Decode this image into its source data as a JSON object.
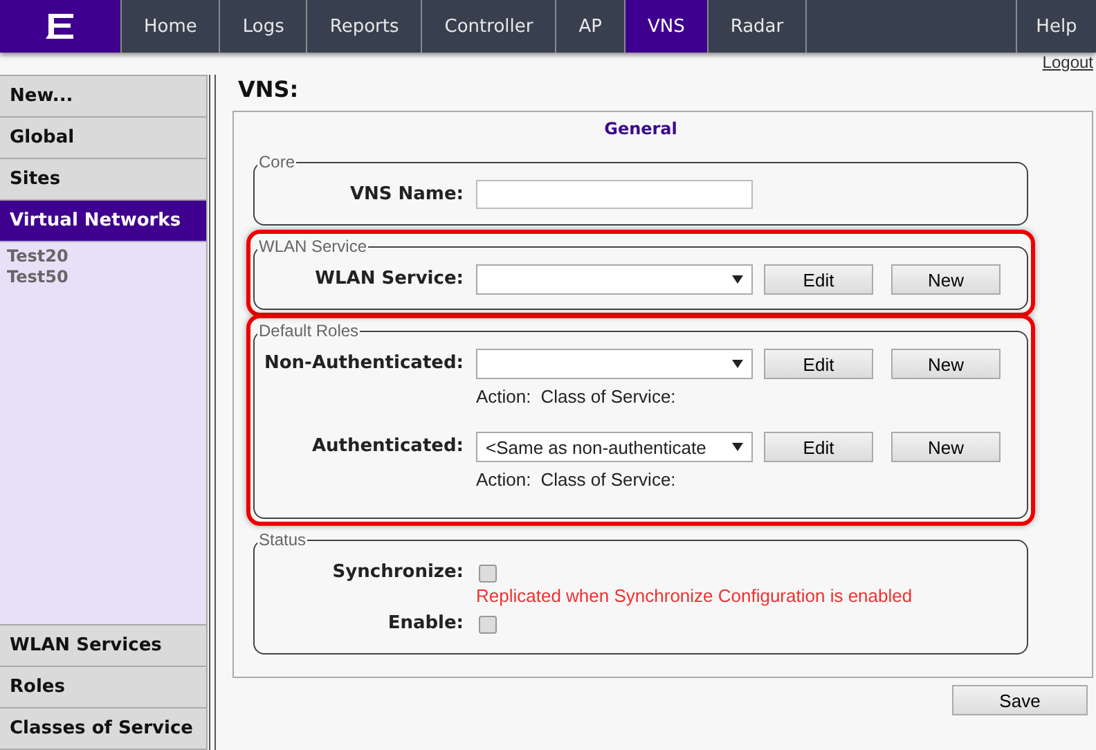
{
  "nav": {
    "tabs": [
      {
        "label": "Home",
        "selected": false
      },
      {
        "label": "Logs",
        "selected": false
      },
      {
        "label": "Reports",
        "selected": false
      },
      {
        "label": "Controller",
        "selected": false
      },
      {
        "label": "AP",
        "selected": false
      },
      {
        "label": "VNS",
        "selected": true
      },
      {
        "label": "Radar",
        "selected": false
      }
    ],
    "help": "Help",
    "logout": "Logout"
  },
  "sidebar": {
    "top_items": [
      {
        "label": "New...",
        "selected": false
      },
      {
        "label": "Global",
        "selected": false
      },
      {
        "label": "Sites",
        "selected": false
      },
      {
        "label": "Virtual Networks",
        "selected": true
      }
    ],
    "children": [
      "Test20",
      "Test50"
    ],
    "bottom_items": [
      {
        "label": "WLAN Services",
        "selected": false
      },
      {
        "label": "Roles",
        "selected": false
      },
      {
        "label": "Classes of Service",
        "selected": false
      }
    ]
  },
  "page_title": "VNS:",
  "section_tab": "General",
  "groups": [
    {
      "legend": "Core",
      "highlighted": false,
      "rows": [
        {
          "kind": "text",
          "label": "VNS Name:"
        }
      ]
    },
    {
      "legend": "WLAN Service",
      "highlighted": true,
      "rows": [
        {
          "kind": "select",
          "label": "WLAN Service:",
          "buttons": [
            "Edit",
            "New"
          ]
        }
      ]
    },
    {
      "legend": "Default Roles",
      "highlighted": true,
      "rows": [
        {
          "kind": "select",
          "label": "Non-Authenticated:",
          "buttons": [
            "Edit",
            "New"
          ],
          "info": [
            "Action:",
            "Class of Service:"
          ]
        },
        {
          "kind": "select",
          "label": "Authenticated:",
          "value": "<Same as non-authenticate",
          "buttons": [
            "Edit",
            "New"
          ],
          "info": [
            "Action:",
            "Class of Service:"
          ]
        }
      ]
    },
    {
      "legend": "Status",
      "highlighted": false,
      "rows": [
        {
          "kind": "checkbox",
          "label": "Synchronize:",
          "checked": false,
          "note": "Replicated when Synchronize Configuration is enabled"
        },
        {
          "kind": "checkbox",
          "label": "Enable:",
          "checked": false
        }
      ]
    }
  ],
  "save_button": "Save"
}
